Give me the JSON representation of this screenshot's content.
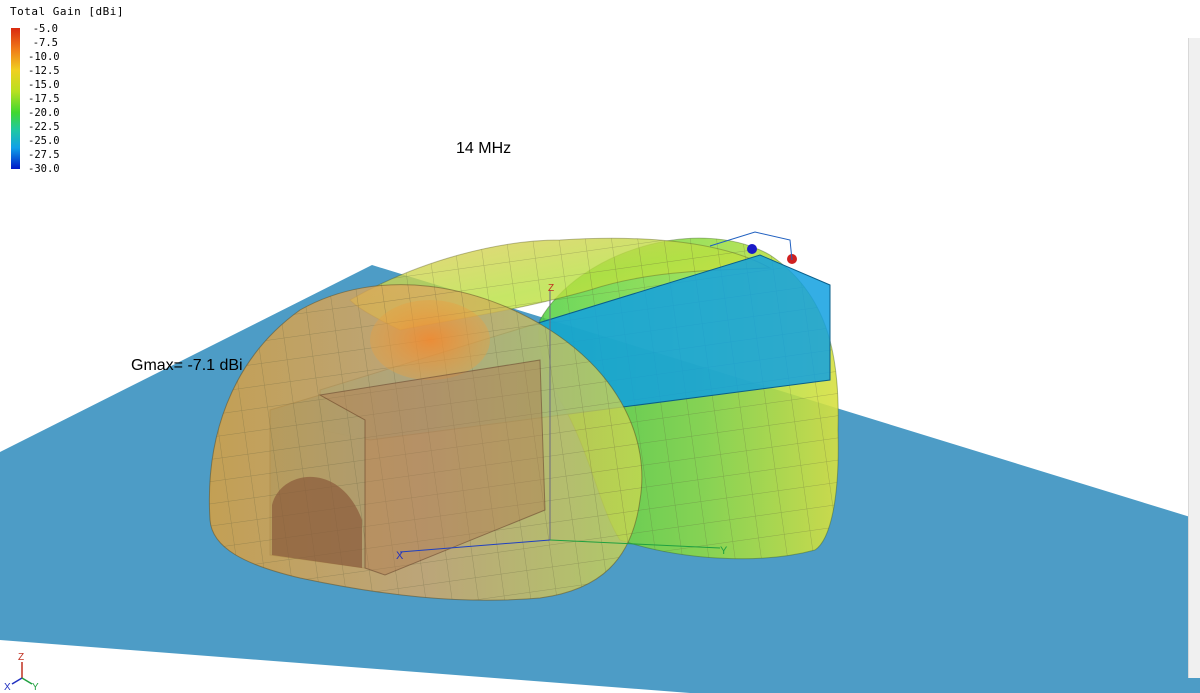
{
  "legend": {
    "title": "Total Gain [dBi]",
    "ticks": [
      "-5.0",
      "-7.5",
      "-10.0",
      "-12.5",
      "-15.0",
      "-17.5",
      "-20.0",
      "-22.5",
      "-25.0",
      "-27.5",
      "-30.0"
    ],
    "colors": [
      "#d92a10",
      "#f07a18",
      "#f0d020",
      "#b8e020",
      "#40d830",
      "#20c8a0",
      "#10a0e8",
      "#0018c8"
    ]
  },
  "plot": {
    "frequency_label": "14 MHz",
    "gmax_label": "Gmax= -7.1 dBi",
    "axis_labels": {
      "x": "X",
      "y": "Y",
      "z": "Z"
    },
    "colors": {
      "ground_plane": "#4d9cc6",
      "antenna_body": "#10a0e0",
      "pattern_orange": "#e8a040",
      "pattern_green": "#50d040",
      "pattern_yellow": "#d8e040"
    }
  },
  "triad": {
    "x": "X",
    "y": "Y",
    "z": "Z"
  }
}
